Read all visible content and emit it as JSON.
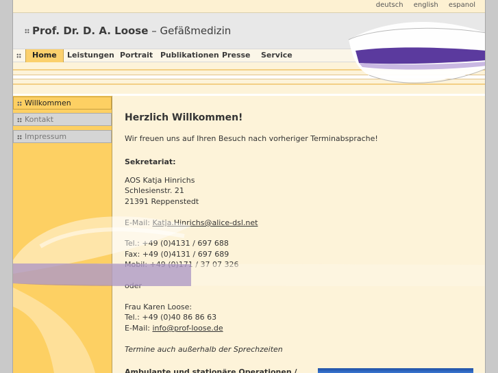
{
  "languages": [
    "deutsch",
    "english",
    "espanol"
  ],
  "site": {
    "name": "Prof. Dr. D. A. Loose",
    "separator": "–",
    "subtitle": "Gefäßmedizin"
  },
  "nav": [
    {
      "label": "Home",
      "active": true
    },
    {
      "label": "Leistungen"
    },
    {
      "label": "Portrait"
    },
    {
      "label": "Publikationen"
    },
    {
      "label": "Presse"
    },
    {
      "label": "Service"
    }
  ],
  "sidebar": [
    {
      "label": "Willkommen",
      "active": true
    },
    {
      "label": "Kontakt"
    },
    {
      "label": "Impressum"
    }
  ],
  "content": {
    "heading": "Herzlich Willkommen!",
    "intro": "Wir freuen uns auf Ihren Besuch nach vorheriger Terminabsprache!",
    "secretariat_label": "Sekretariat:",
    "address": [
      "AOS Katja Hinrichs",
      "Schlesienstr. 21",
      "21391 Reppenstedt"
    ],
    "email1_prefix": "E-Mail: ",
    "email1": "Katja.Hinrichs@alice-dsl.net",
    "tel1": "Tel.: +49 (0)4131 / 697 688",
    "fax1": "Fax: +49 (0)4131 / 697 689",
    "mobil1": "Mobil: +49 (0)171 / 37 07 326",
    "or": "oder",
    "contact2_name": "Frau Karen Loose:",
    "tel2": "Tel.: +49 (0)40 86 86 63",
    "email2_prefix": "E-Mail: ",
    "email2": "info@prof-loose.de",
    "note": "Termine auch außerhalb der Sprechzeiten",
    "cutoff": "Ambulante und stationäre Operationen /"
  },
  "colors": {
    "accent": "#fdd063",
    "content_bg": "#fdf3d9",
    "purple_band": "#5b3a9e",
    "header_bg": "#e8e8e8"
  }
}
